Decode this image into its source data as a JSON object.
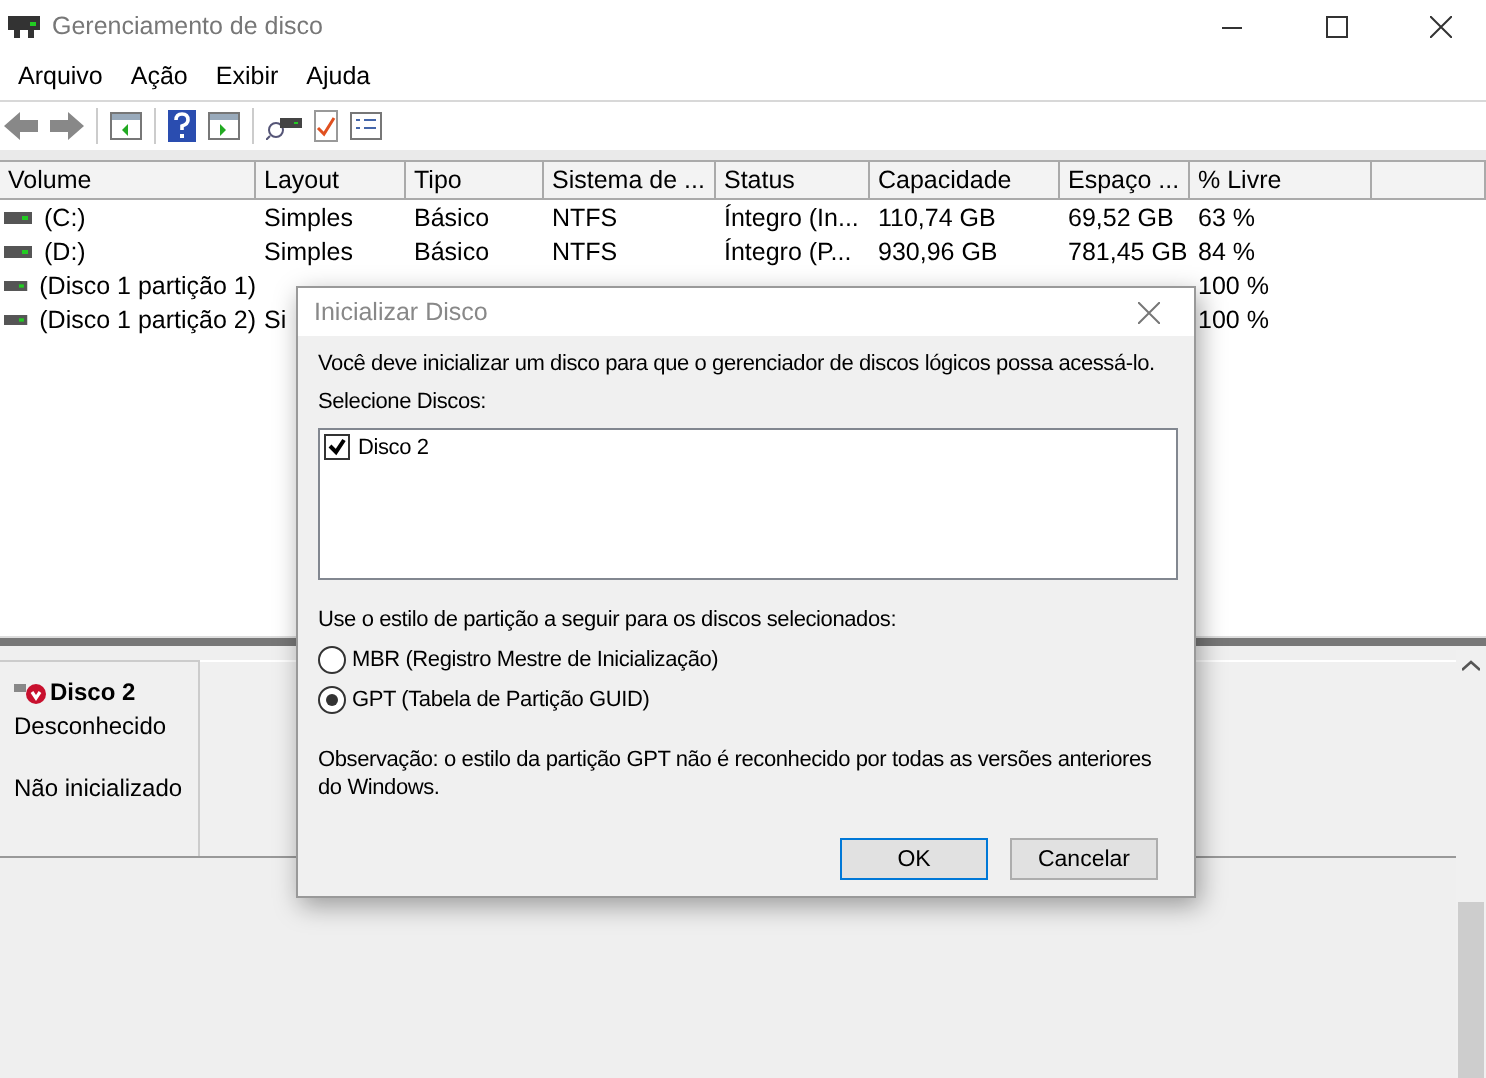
{
  "window": {
    "title": "Gerenciamento de disco"
  },
  "menu": [
    "Arquivo",
    "Ação",
    "Exibir",
    "Ajuda"
  ],
  "table": {
    "columns": [
      "Volume",
      "Layout",
      "Tipo",
      "Sistema de ...",
      "Status",
      "Capacidade",
      "Espaço ...",
      "% Livre"
    ],
    "rows": [
      {
        "volume": "(C:)",
        "layout": "Simples",
        "tipo": "Básico",
        "sistema": "NTFS",
        "status": "Íntegro (In...",
        "capacidade": "110,74 GB",
        "espaco": "69,52 GB",
        "livre": "63 %"
      },
      {
        "volume": "(D:)",
        "layout": "Simples",
        "tipo": "Básico",
        "sistema": "NTFS",
        "status": "Íntegro (P...",
        "capacidade": "930,96 GB",
        "espaco": "781,45 GB",
        "livre": "84 %"
      },
      {
        "volume": "(Disco 1 partição 1)",
        "livre": "100 %"
      },
      {
        "volume": "(Disco 1 partição 2)",
        "layout": "Si",
        "livre": "100 %"
      }
    ]
  },
  "disk": {
    "name": "Disco 2",
    "type": "Desconhecido",
    "status": "Não inicializado"
  },
  "dialog": {
    "title": "Inicializar Disco",
    "message": "Você deve inicializar um disco para que o gerenciador de discos lógicos possa acessá-lo.",
    "select_label": "Selecione Discos:",
    "disks": [
      {
        "label": "Disco 2",
        "checked": true
      }
    ],
    "style_label": "Use o estilo de partição a seguir para os discos selecionados:",
    "styles": [
      {
        "label": "MBR (Registro Mestre de Inicialização)",
        "selected": false
      },
      {
        "label": "GPT (Tabela de Partição GUID)",
        "selected": true
      }
    ],
    "note": "Observação: o estilo da partição GPT não é reconhecido por todas as versões anteriores do Windows.",
    "buttons": [
      "OK",
      "Cancelar"
    ]
  }
}
